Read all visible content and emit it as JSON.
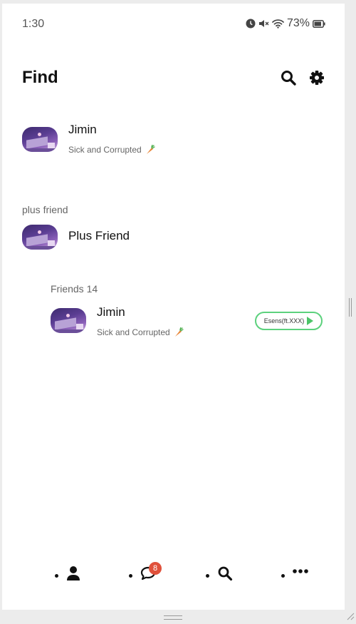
{
  "status_bar": {
    "time": "1:30",
    "battery": "73%",
    "icons": [
      "alarm-icon",
      "mute-icon",
      "wifi-icon",
      "battery-icon"
    ]
  },
  "header": {
    "title": "Find",
    "icons": [
      "search-icon",
      "gear-icon"
    ]
  },
  "my_profile": {
    "name": "Jimin",
    "status": "Sick and Corrupted",
    "status_icon": "carrot-icon"
  },
  "plus_friend": {
    "section_label": "plus friend",
    "name": "Plus Friend"
  },
  "friends": {
    "section_label": "Friends 14",
    "items": [
      {
        "name": "Jimin",
        "status": "Sick and Corrupted",
        "status_icon": "carrot-icon",
        "song": "Esens(ft.XXX)"
      }
    ]
  },
  "bottom_nav": {
    "items": [
      {
        "icon": "person-icon"
      },
      {
        "icon": "chat-icon",
        "badge": "8"
      },
      {
        "icon": "search-icon"
      },
      {
        "icon": "more-icon"
      }
    ]
  },
  "colors": {
    "accent_green": "#5cd17d",
    "badge_red": "#e0513b"
  }
}
